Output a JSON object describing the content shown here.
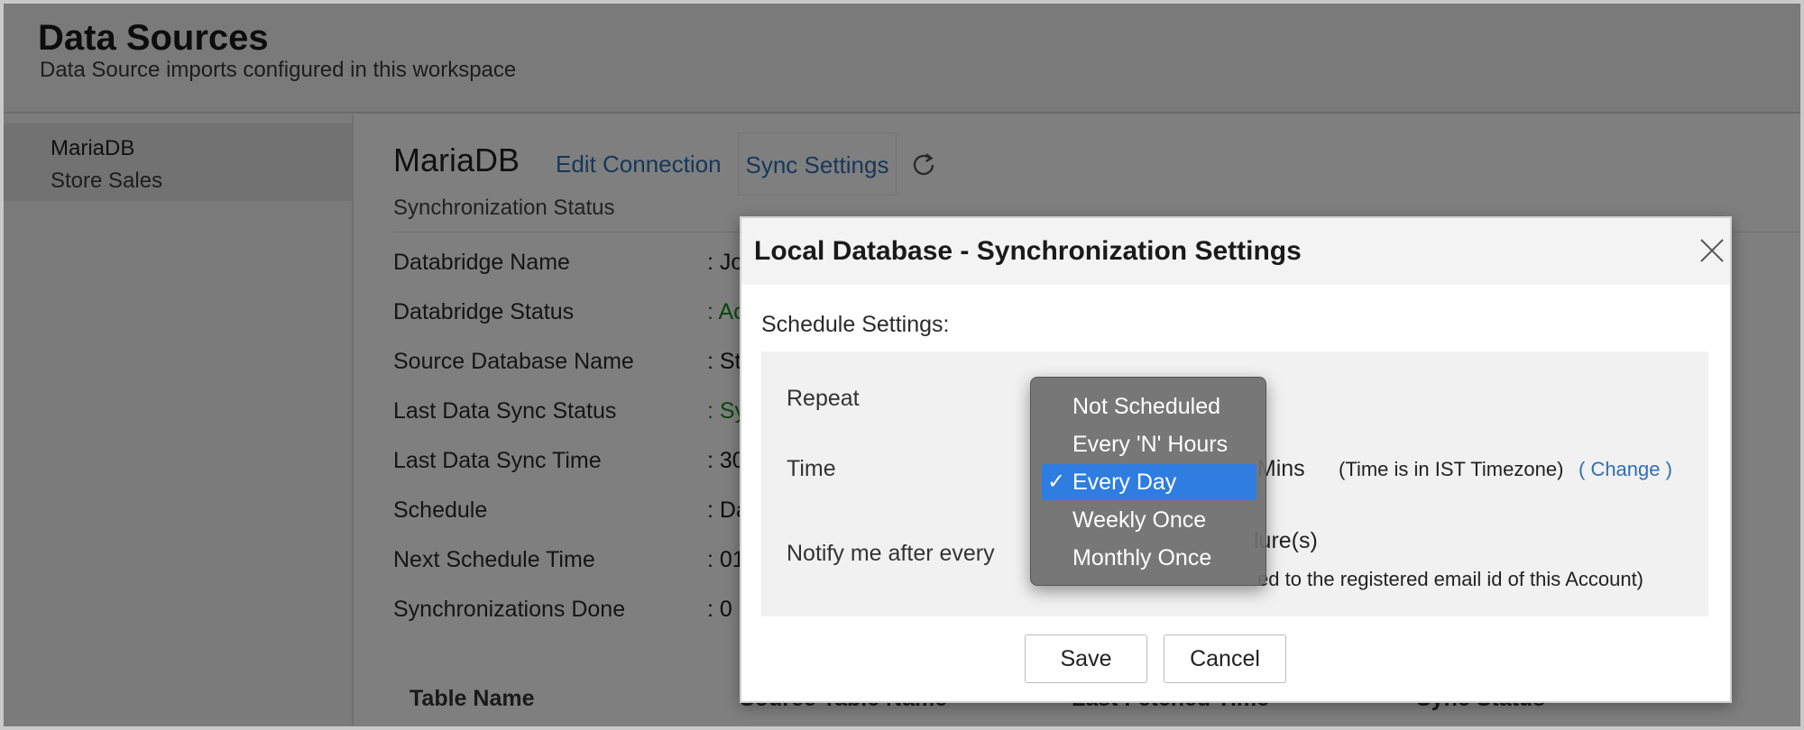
{
  "header": {
    "title": "Data Sources",
    "subtitle": "Data Source imports configured in this workspace"
  },
  "sidebar": {
    "items": [
      {
        "db": "MariaDB",
        "name": "Store Sales"
      }
    ]
  },
  "main": {
    "title": "MariaDB",
    "edit_connection": "Edit Connection",
    "sync_settings": "Sync Settings",
    "refresh_icon": "refresh-icon",
    "sync_status_heading": "Synchronization Status",
    "rows": [
      {
        "label": "Databridge Name",
        "value": ": Jo"
      },
      {
        "label": "Databridge Status",
        "value": ": Ac"
      },
      {
        "label": "Source Database Name",
        "value": ": St"
      },
      {
        "label": "Last Data Sync Status",
        "value": ": Sy"
      },
      {
        "label": "Last Data Sync Time",
        "value": ": 30"
      },
      {
        "label": "Schedule",
        "value": ": Da"
      },
      {
        "label": "Next Schedule Time",
        "value": ": 01"
      },
      {
        "label": "Synchronizations Done",
        "value": ": 0"
      }
    ],
    "table_headers": [
      "Table Name",
      "Source Table Name",
      "Last Fetched Time",
      "Sync Status"
    ]
  },
  "dialog": {
    "title": "Local Database - Synchronization Settings",
    "close_icon": "close-icon",
    "schedule_label": "Schedule Settings:",
    "repeat_label": "Repeat",
    "time_label": "Time",
    "mins_label": ", Mins",
    "timezone_note": "(Time is in IST Timezone)",
    "change_link": "( Change )",
    "notify_label": "Notify me after every",
    "failure_suffix": "lure(s)",
    "notify_note": "ed to the registered email id of this Account)",
    "save_button": "Save",
    "cancel_button": "Cancel"
  },
  "dropdown": {
    "options": [
      "Not Scheduled",
      "Every 'N' Hours",
      "Every Day",
      "Weekly Once",
      "Monthly Once"
    ],
    "selected": "Every Day",
    "check_mark": "✓"
  },
  "colors": {
    "link": "#2f6fb5",
    "status_green": "#1b8a1b",
    "selected_option": "#2f7de1"
  }
}
